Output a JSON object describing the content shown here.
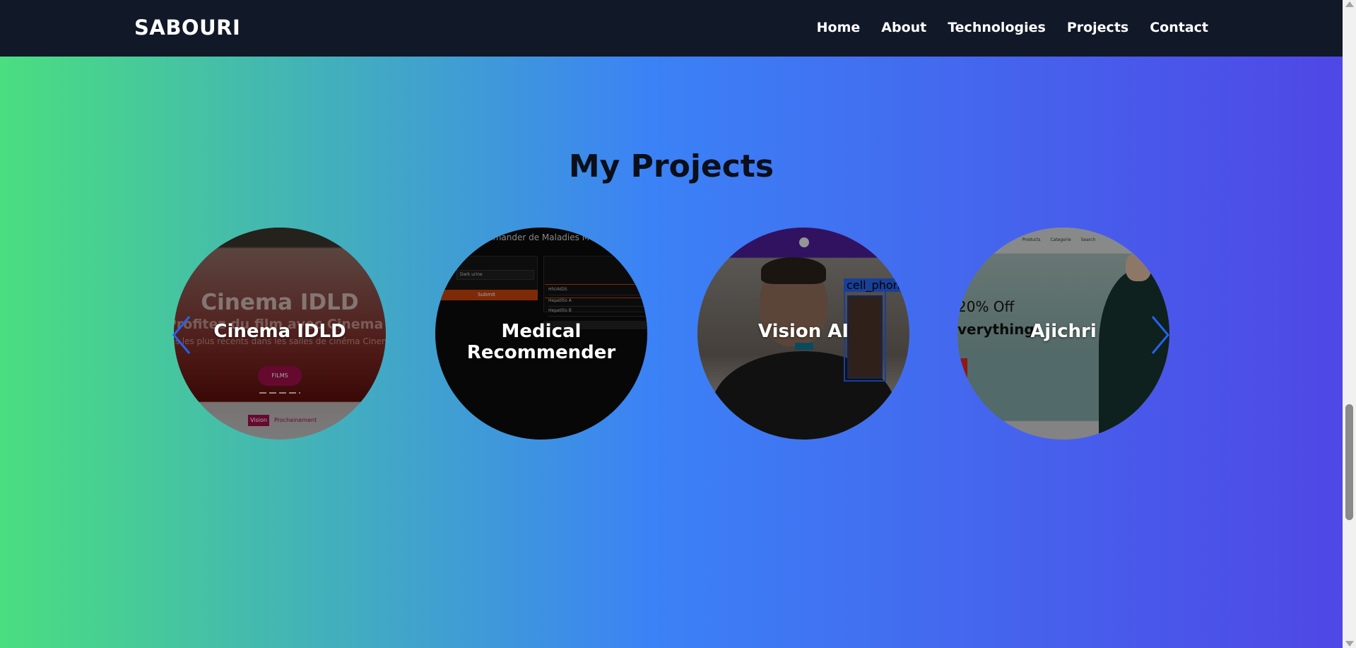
{
  "nav": {
    "brand": "SABOURI",
    "links": [
      "Home",
      "About",
      "Technologies",
      "Projects",
      "Contact"
    ]
  },
  "projects_section": {
    "title": "My Projects",
    "cards": [
      {
        "title": "Cinema IDLD",
        "thumb_heading": "Cinema IDLD",
        "thumb_subheading": "Profitez du film avec Cinema IDLD",
        "thumb_caption": "ms les plus récents dans les salles de cinéma Cinema",
        "thumb_button": "FILMS",
        "thumb_tag": "Vision",
        "thumb_link": "Prochainement"
      },
      {
        "title": "Medical Recommender",
        "thumb_heading": "mmander de Maladies Méd",
        "thumb_select": "Dark urine",
        "thumb_button": "Submit",
        "thumb_rows": [
          "HIV/AIDS",
          "Hepatitis A",
          "Hepatitis B"
        ]
      },
      {
        "title": "Vision AI",
        "thumb_label": "cell_phon"
      },
      {
        "title": "Ajichri",
        "thumb_nav": "Home Products Categorie Search",
        "thumb_offer": "20% Off",
        "thumb_offer_line2": "verything"
      }
    ]
  },
  "colors": {
    "navbar": "#111827",
    "gradient_start": "#4ade80",
    "gradient_mid": "#3b82f6",
    "gradient_end": "#4f46e5",
    "arrow": "#2563eb"
  },
  "icons": {
    "prev": "chevron-left-icon",
    "next": "chevron-right-icon"
  }
}
